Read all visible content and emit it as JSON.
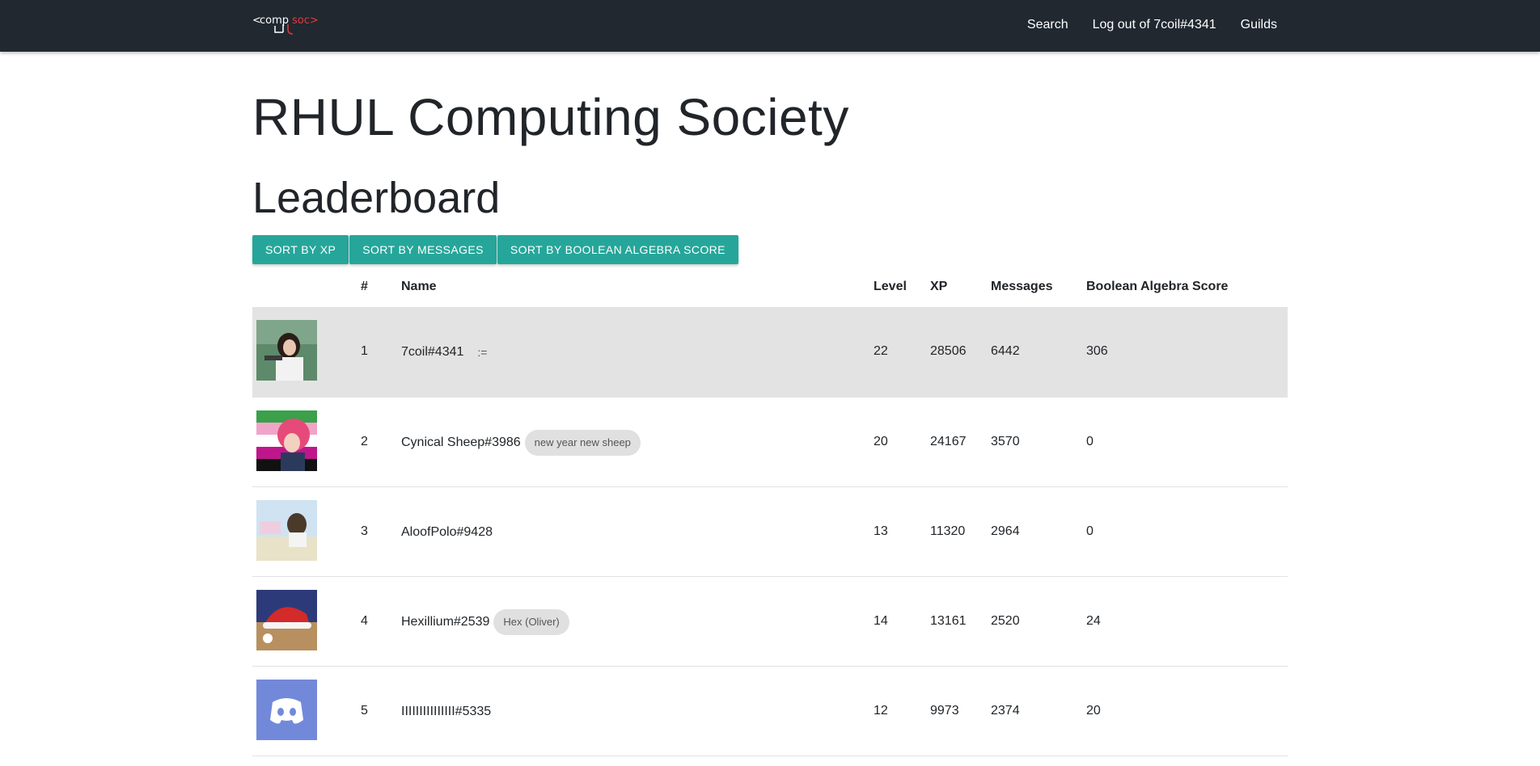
{
  "nav": {
    "logo": {
      "lt": "<",
      "comp": "comp",
      "soc": "soc>"
    },
    "links": [
      "Search",
      "Log out of 7coil#4341",
      "Guilds"
    ]
  },
  "page": {
    "title": "RHUL Computing Society",
    "section": "Leaderboard"
  },
  "sort_buttons": [
    "SORT BY XP",
    "SORT BY MESSAGES",
    "SORT BY BOOLEAN ALGEBRA SCORE"
  ],
  "table": {
    "headers": {
      "rank": "#",
      "name": "Name",
      "level": "Level",
      "xp": "XP",
      "messages": "Messages",
      "bool": "Boolean Algebra Score"
    },
    "rows": [
      {
        "rank": "1",
        "name": "7coil#4341",
        "chip": "",
        "edit": ":=",
        "level": "22",
        "xp": "28506",
        "messages": "6442",
        "bool": "306"
      },
      {
        "rank": "2",
        "name": "Cynical Sheep#3986",
        "chip": "new year new sheep",
        "edit": "",
        "level": "20",
        "xp": "24167",
        "messages": "3570",
        "bool": "0"
      },
      {
        "rank": "3",
        "name": "AloofPolo#9428",
        "chip": "",
        "edit": "",
        "level": "13",
        "xp": "11320",
        "messages": "2964",
        "bool": "0"
      },
      {
        "rank": "4",
        "name": "Hexillium#2539",
        "chip": "Hex (Oliver)",
        "edit": "",
        "level": "14",
        "xp": "13161",
        "messages": "2520",
        "bool": "24"
      },
      {
        "rank": "5",
        "name": "IIIIIIIIIIIIIII#5335",
        "chip": "",
        "edit": "",
        "level": "12",
        "xp": "9973",
        "messages": "2374",
        "bool": "20"
      }
    ]
  },
  "colors": {
    "navbar": "#212830",
    "accent": "#26a69a",
    "highlight_row": "#e3e3e3",
    "logo_red": "#e23b3b"
  }
}
